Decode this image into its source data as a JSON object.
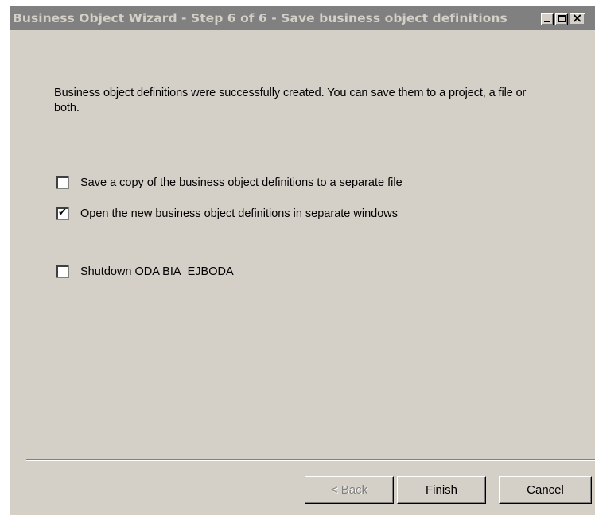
{
  "window": {
    "title": "Business Object Wizard - Step 6 of 6 - Save business object definitions"
  },
  "title_buttons": {
    "minimize": "minimize-icon",
    "maximize": "maximize-icon",
    "close": "close-icon",
    "close_glyph": "×"
  },
  "intro": {
    "text": "Business object definitions were successfully created. You can save them to a project, a file or both."
  },
  "options": [
    {
      "label": "Save a copy of the business object definitions to a separate file",
      "checked": false
    },
    {
      "label": "Open the new business object definitions in separate windows",
      "checked": true
    },
    {
      "label": "Shutdown ODA BIA_EJBODA",
      "checked": false
    }
  ],
  "check_glyph": "✔",
  "buttons": {
    "back": "< Back",
    "finish": "Finish",
    "cancel": "Cancel",
    "back_enabled": false
  },
  "colors": {
    "titlebar_bg": "#808080",
    "title_text": "#d4d0c8",
    "dialog_bg": "#d4d0c8",
    "disabled_text": "#808080"
  }
}
